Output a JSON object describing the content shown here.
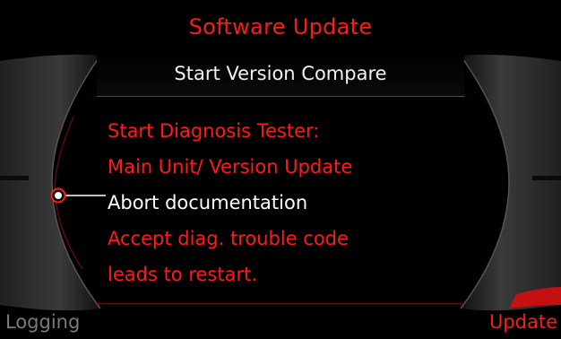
{
  "screen": {
    "title": "Software Update",
    "header": "Start Version Compare",
    "menu_items": [
      {
        "label": "Start Diagnosis Tester:",
        "selected": false
      },
      {
        "label": "Main Unit/ Version Update",
        "selected": false
      },
      {
        "label": "Abort documentation",
        "selected": true
      },
      {
        "label": "Accept diag. trouble code",
        "selected": false
      },
      {
        "label": "leads to restart.",
        "selected": false
      }
    ],
    "softkeys": {
      "left": "Logging",
      "right": "Update"
    }
  },
  "colors": {
    "accent": "#ff1a1a",
    "text_selected": "#ffffff",
    "softkey_inactive": "#7a7a7a",
    "background": "#000000"
  },
  "icons": {
    "selector": "selection-dot-icon",
    "left_bezel": "left-control-knob-icon",
    "right_bezel": "right-control-knob-icon"
  }
}
